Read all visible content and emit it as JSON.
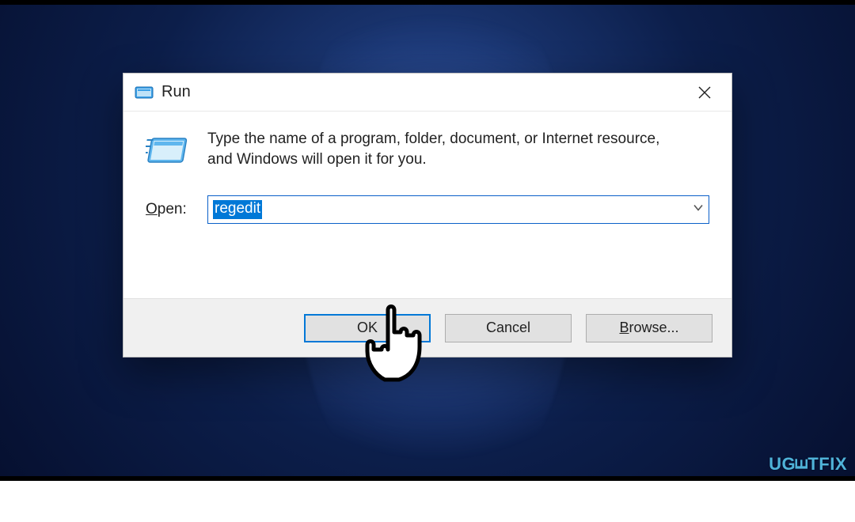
{
  "dialog": {
    "title": "Run",
    "description": "Type the name of a program, folder, document, or Internet resource, and Windows will open it for you.",
    "open_label_html": "Open:",
    "open_label_underline": "O",
    "open_label_rest": "pen:",
    "input_value": "regedit",
    "buttons": {
      "ok": "OK",
      "cancel": "Cancel",
      "browse_underline": "B",
      "browse_rest": "rowse..."
    }
  },
  "watermark": {
    "text_pre": "UG",
    "text_mid": "Ǝ",
    "text_post": "TFIX"
  },
  "icons": {
    "run_small": "run-icon",
    "run_large": "run-large-icon",
    "close": "close-icon",
    "dropdown": "chevron-down-icon",
    "cursor": "pointer-cursor-icon"
  }
}
